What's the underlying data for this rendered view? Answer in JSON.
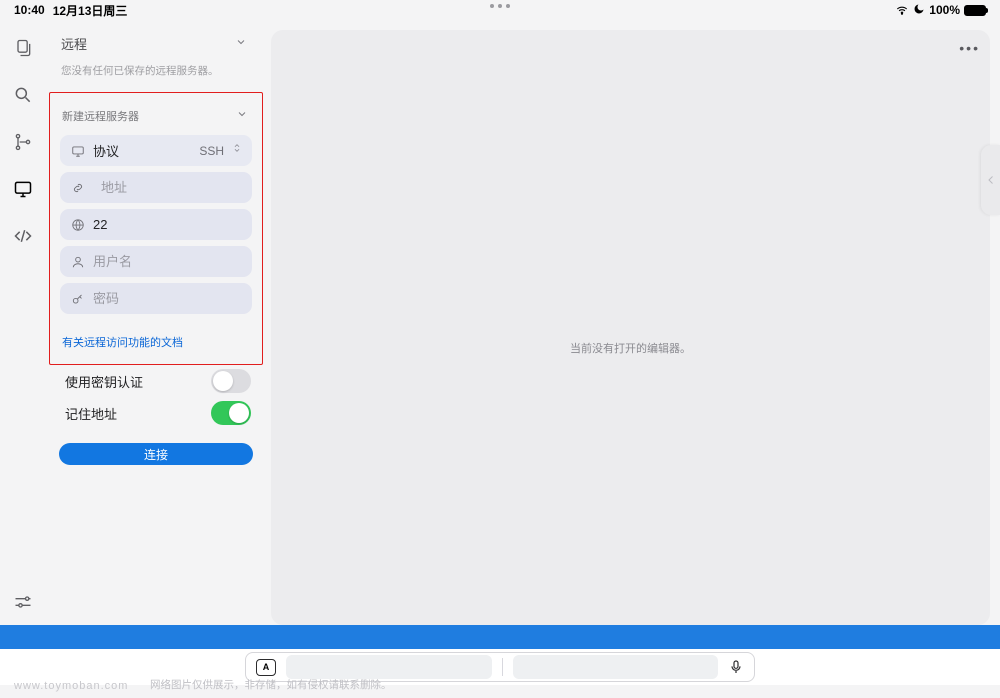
{
  "status": {
    "time": "10:40",
    "date": "12月13日周三",
    "battery": "100%"
  },
  "sidebar": {
    "title": "远程",
    "hint": "您没有任何已保存的远程服务器。",
    "form": {
      "title": "新建远程服务器",
      "protocol_label": "协议",
      "protocol_value": "SSH",
      "address_placeholder": "地址",
      "port_value": "22",
      "username_placeholder": "用户名",
      "password_placeholder": "密码",
      "doc_link": "有关远程访问功能的文档"
    },
    "toggles": {
      "key_auth_label": "使用密钥认证",
      "key_auth": false,
      "remember_label": "记住地址",
      "remember": true
    },
    "connect_label": "连接"
  },
  "editor": {
    "empty_msg": "当前没有打开的编辑器。",
    "more": "•••"
  },
  "inputbar": {
    "mode": "A"
  },
  "watermark": {
    "host": "www.toymoban.com",
    "text": "网络图片仅供展示，非存储，如有侵权请联系删除。"
  }
}
